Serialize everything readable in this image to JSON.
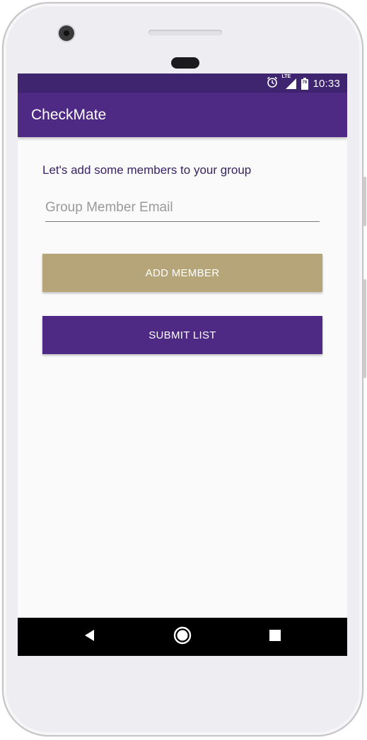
{
  "status_bar": {
    "time": "10:33",
    "icons": [
      "alarm-icon",
      "lte-signal-icon",
      "battery-icon"
    ],
    "battery_level": "79",
    "network_label": "LTE"
  },
  "app_bar": {
    "title": "CheckMate"
  },
  "main": {
    "prompt": "Let's add some members to your group",
    "email_input": {
      "placeholder": "Group Member Email",
      "value": ""
    },
    "add_member_label": "ADD MEMBER",
    "submit_list_label": "SUBMIT LIST"
  },
  "nav_bar": {
    "icons": [
      "back-icon",
      "home-icon",
      "recents-icon"
    ]
  },
  "colors": {
    "primary": "#4e2a84",
    "primary_dark": "#3f2470",
    "accent_gold": "#b7a57a",
    "prompt_text": "#3a2266"
  }
}
